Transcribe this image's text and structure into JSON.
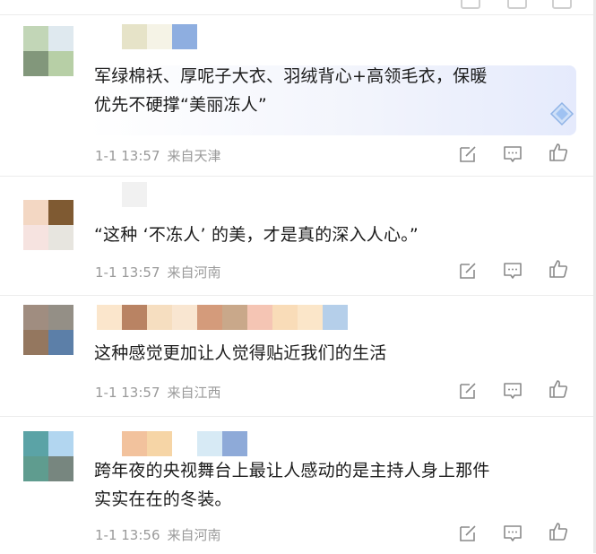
{
  "comments": [
    {
      "text_line1": "军绿棉袄、厚呢子大衣、羽绒背心+高领毛衣，保暖",
      "text_line2": "优先不硬撑“美丽冻人”",
      "date": "1-1 13:57",
      "location": "来自天津",
      "avatar_colors": [
        "#c2d6b7",
        "#dfe9ef",
        "#82977b",
        "#b7cfa6"
      ],
      "name_colors": [
        "#ffffff",
        "#e6e3c8",
        "#f5f3e6",
        "#8eaee0"
      ]
    },
    {
      "text_line1": "“这种 ‘不冻人’ 的美，才是真的深入人心。”",
      "text_line2": "",
      "date": "1-1 13:57",
      "location": "来自河南",
      "avatar_colors": [
        "#f3d7c3",
        "#7f5a32",
        "#f6e3e0",
        "#e7e5df"
      ],
      "name_colors": [
        "#ffffff",
        "#f1f1f1",
        "#ffffff",
        "#ffffff"
      ]
    },
    {
      "text_line1": "这种感觉更加让人觉得贴近我们的生活",
      "text_line2": "",
      "date": "1-1 13:57",
      "location": "来自江西",
      "avatar_colors": [
        "#a08d80",
        "#948f86",
        "#94775f",
        "#5c7fa8"
      ],
      "name_colors": [
        "#fbe6cc",
        "#b98363",
        "#f6dec0",
        "#f9e6d1",
        "#d49b7b",
        "#c9a88a",
        "#f5c5b4",
        "#f9dcb8",
        "#fbe6c9",
        "#b5cfea"
      ]
    },
    {
      "text_line1": "跨年夜的央视舞台上最让人感动的是主持人身上那件",
      "text_line2": "实实在在的冬装。",
      "date": "1-1 13:56",
      "location": "来自河南",
      "avatar_colors": [
        "#5ba3a6",
        "#b2d6f0",
        "#5f9c8f",
        "#77867f"
      ],
      "name_colors": [
        "#ffffff",
        "#f2c29d",
        "#f6d5a6",
        "#ffffff",
        "#d7eaf5",
        "#8eaad8"
      ]
    }
  ],
  "icons": [
    "edit-icon",
    "comment-icon",
    "like-icon"
  ]
}
